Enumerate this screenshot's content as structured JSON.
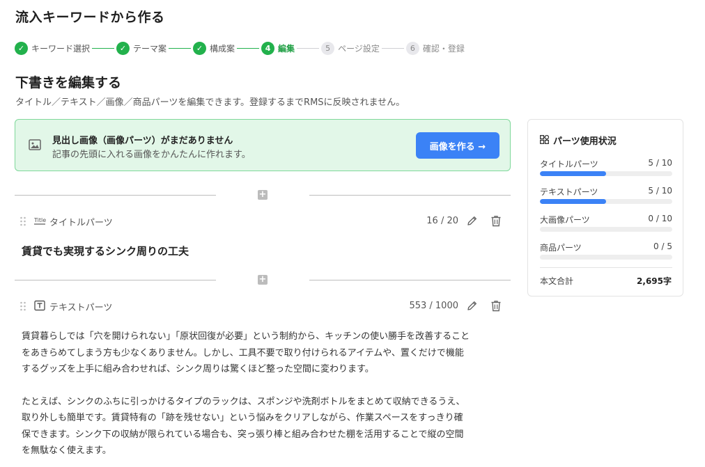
{
  "page": {
    "title": "流入キーワードから作る"
  },
  "stepper": {
    "steps": [
      {
        "num": "✓",
        "label": "キーワード選択",
        "state": "done"
      },
      {
        "num": "✓",
        "label": "テーマ案",
        "state": "done"
      },
      {
        "num": "✓",
        "label": "構成案",
        "state": "done"
      },
      {
        "num": "4",
        "label": "編集",
        "state": "current"
      },
      {
        "num": "5",
        "label": "ページ設定",
        "state": "todo"
      },
      {
        "num": "6",
        "label": "確認・登録",
        "state": "todo"
      }
    ]
  },
  "section": {
    "title": "下書きを編集する",
    "description": "タイトル／テキスト／画像／商品パーツを編集できます。登録するまでRMSに反映されません。"
  },
  "banner": {
    "title": "見出し画像（画像パーツ）がまだありません",
    "subtitle": "記事の先頭に入れる画像をかんたんに作れます。",
    "button_label": "画像を作る →"
  },
  "divider": {
    "add_label": "+"
  },
  "title_part": {
    "icon_text": "Title",
    "label": "タイトルパーツ",
    "count": "16 / 20",
    "content": "賃貸でも実現するシンク周りの工夫"
  },
  "text_part": {
    "label": "テキストパーツ",
    "count": "553 / 1000",
    "paragraphs": [
      "賃貸暮らしでは「穴を開けられない」「原状回復が必要」という制約から、キッチンの使い勝手を改善すること\nをあきらめてしまう方も少なくありません。しかし、工具不要で取り付けられるアイテムや、置くだけで機能\nするグッズを上手に組み合わせれば、シンク周りは驚くほど整った空間に変わります。",
      "たとえば、シンクのふちに引っかけるタイプのラックは、スポンジや洗剤ボトルをまとめて収納できるうえ、\n取り外しも簡単です。賃貸特有の「跡を残せない」という悩みをクリアしながら、作業スペースをすっきり確\n保できます。シンク下の収納が限られている場合も、突っ張り棒と組み合わせた棚を活用することで縦の空間\nを無駄なく使えます。"
    ]
  },
  "sidebar": {
    "title": "パーツ使用状況",
    "rows": [
      {
        "label": "タイトルパーツ",
        "value": "5 / 10",
        "ratio": 0.5
      },
      {
        "label": "テキストパーツ",
        "value": "5 / 10",
        "ratio": 0.5
      },
      {
        "label": "大画像パーツ",
        "value": "0 / 10",
        "ratio": 0
      },
      {
        "label": "商品パーツ",
        "value": "0 / 5",
        "ratio": 0
      }
    ],
    "total_label": "本文合計",
    "total_value": "2,695字"
  },
  "colors": {
    "accent": "#3b82f6",
    "success": "#22b14c",
    "banner_bg": "#e2f7e8"
  }
}
